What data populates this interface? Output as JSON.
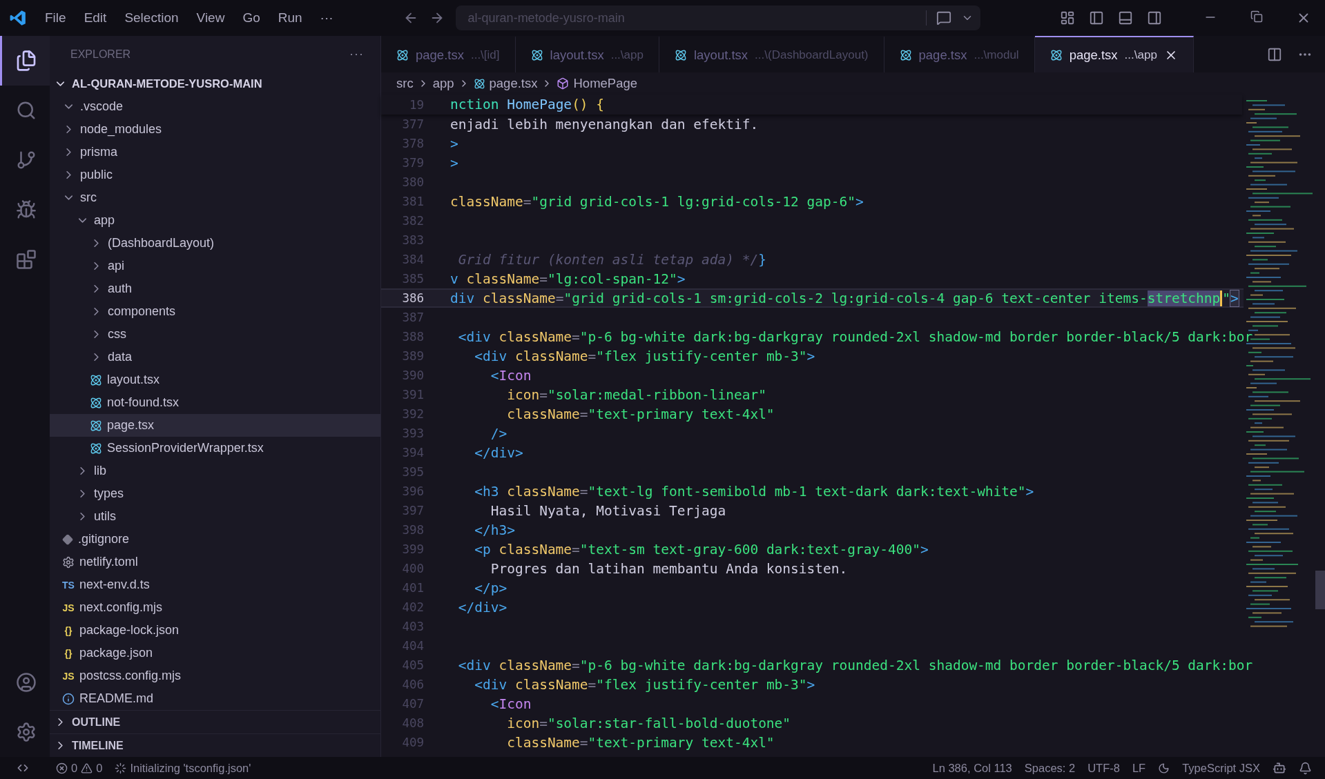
{
  "menu": [
    "File",
    "Edit",
    "Selection",
    "View",
    "Go",
    "Run",
    "···"
  ],
  "command_center": {
    "value": "al-quran-metode-yusro-main"
  },
  "sidebar": {
    "title": "EXPLORER",
    "more": "···",
    "root": {
      "label": "AL-QURAN-METODE-YUSRO-MAIN",
      "expanded": true
    },
    "tree": [
      {
        "name": ".vscode",
        "kind": "folder",
        "expanded": true,
        "selected": false
      },
      {
        "name": "node_modules",
        "kind": "folder",
        "expanded": false,
        "selected": false
      },
      {
        "name": "prisma",
        "kind": "folder",
        "expanded": false,
        "selected": false
      },
      {
        "name": "public",
        "kind": "folder",
        "expanded": false,
        "selected": false
      },
      {
        "name": "src",
        "kind": "folder",
        "expanded": true,
        "selected": false,
        "children": [
          {
            "name": "app",
            "kind": "folder",
            "expanded": true,
            "selected": false,
            "children": [
              {
                "name": "(DashboardLayout)",
                "kind": "folder",
                "expanded": false,
                "selected": false
              },
              {
                "name": "api",
                "kind": "folder",
                "expanded": false,
                "selected": false
              },
              {
                "name": "auth",
                "kind": "folder",
                "expanded": false,
                "selected": false
              },
              {
                "name": "components",
                "kind": "folder",
                "expanded": false,
                "selected": false
              },
              {
                "name": "css",
                "kind": "folder",
                "expanded": false,
                "selected": false
              },
              {
                "name": "data",
                "kind": "folder",
                "expanded": false,
                "selected": false
              },
              {
                "name": "layout.tsx",
                "kind": "react",
                "selected": false
              },
              {
                "name": "not-found.tsx",
                "kind": "react",
                "selected": false
              },
              {
                "name": "page.tsx",
                "kind": "react",
                "selected": true
              },
              {
                "name": "SessionProviderWrapper.tsx",
                "kind": "react",
                "selected": false
              }
            ]
          },
          {
            "name": "lib",
            "kind": "folder",
            "expanded": false,
            "selected": false
          },
          {
            "name": "types",
            "kind": "folder",
            "expanded": false,
            "selected": false
          },
          {
            "name": "utils",
            "kind": "folder",
            "expanded": false,
            "selected": false
          }
        ]
      },
      {
        "name": ".gitignore",
        "kind": "git",
        "selected": false
      },
      {
        "name": "netlify.toml",
        "kind": "gear",
        "selected": false
      },
      {
        "name": "next-env.d.ts",
        "kind": "ts",
        "glyph": "TS",
        "selected": false
      },
      {
        "name": "next.config.mjs",
        "kind": "js",
        "glyph": "JS",
        "selected": false
      },
      {
        "name": "package-lock.json",
        "kind": "json",
        "glyph": "{}",
        "selected": false
      },
      {
        "name": "package.json",
        "kind": "json",
        "glyph": "{}",
        "selected": false
      },
      {
        "name": "postcss.config.mjs",
        "kind": "js",
        "glyph": "JS",
        "selected": false
      },
      {
        "name": "README.md",
        "kind": "info",
        "selected": false
      }
    ],
    "sections": [
      {
        "label": "OUTLINE",
        "expanded": false
      },
      {
        "label": "TIMELINE",
        "expanded": false
      }
    ]
  },
  "tabs": [
    {
      "name": "page.tsx",
      "path": "...\\[id]",
      "selected": false
    },
    {
      "name": "layout.tsx",
      "path": "...\\app",
      "selected": false
    },
    {
      "name": "layout.tsx",
      "path": "...\\(DashboardLayout)",
      "selected": false
    },
    {
      "name": "page.tsx",
      "path": "...\\modul",
      "selected": false
    },
    {
      "name": "page.tsx",
      "path": "...\\app",
      "selected": true
    }
  ],
  "breadcrumb": [
    "src",
    "app",
    "page.tsx",
    "HomePage"
  ],
  "sticky_line": {
    "number": "19",
    "tokens": [
      {
        "text": "nction",
        "kind": "keyword"
      },
      {
        "text": " HomePage",
        "kind": "function"
      },
      {
        "text": "() {",
        "kind": "brace"
      }
    ]
  },
  "lines": [
    {
      "number": "377",
      "current": false,
      "tokens": [
        {
          "text": "enjadi lebih menyenangkan dan efektif.",
          "kind": "plain"
        }
      ]
    },
    {
      "number": "378",
      "current": false,
      "tokens": [
        {
          "text": ">",
          "kind": "tag"
        }
      ]
    },
    {
      "number": "379",
      "current": false,
      "tokens": [
        {
          "text": ">",
          "kind": "tag"
        }
      ]
    },
    {
      "number": "380",
      "current": false
    },
    {
      "number": "381",
      "current": false,
      "tokens": [
        {
          "text": "className",
          "kind": "attr"
        },
        {
          "text": "=",
          "kind": "op"
        },
        {
          "text": "\"grid grid-cols-1 lg:grid-cols-12 gap-6\"",
          "kind": "string"
        },
        {
          "text": ">",
          "kind": "tag"
        }
      ]
    },
    {
      "number": "382",
      "current": false
    },
    {
      "number": "383",
      "current": false
    },
    {
      "number": "384",
      "current": false,
      "tokens": [
        {
          "text": " Grid fitur (konten asli tetap ada) */",
          "kind": "comment"
        },
        {
          "text": "}",
          "kind": "tag"
        }
      ]
    },
    {
      "number": "385",
      "current": false,
      "tokens": [
        {
          "text": "v",
          "kind": "tag"
        },
        {
          "text": " className",
          "kind": "attr"
        },
        {
          "text": "=",
          "kind": "op"
        },
        {
          "text": "\"lg:col-span-12\"",
          "kind": "string"
        },
        {
          "text": ">",
          "kind": "tag"
        }
      ]
    },
    {
      "number": "386",
      "current": true,
      "tokens": [
        {
          "text": "div",
          "kind": "tag"
        },
        {
          "text": " className",
          "kind": "attr"
        },
        {
          "text": "=",
          "kind": "op"
        },
        {
          "text": "\"grid grid-cols-1 sm:grid-cols-2 lg:grid-cols-4 gap-6 text-center items-",
          "kind": "string"
        },
        {
          "text": "stretchnp",
          "kind": "selection"
        },
        {
          "text": "\"",
          "kind": "string"
        },
        {
          "text": ">",
          "kind": "match"
        }
      ]
    },
    {
      "number": "387",
      "current": false
    },
    {
      "number": "388",
      "current": false,
      "tokens": [
        {
          "text": " <div",
          "kind": "tag"
        },
        {
          "text": " className",
          "kind": "attr"
        },
        {
          "text": "=",
          "kind": "op"
        },
        {
          "text": "\"p-6 bg-white dark:bg-darkgray rounded-2xl shadow-md border border-black/5 dark:bor",
          "kind": "string"
        }
      ]
    },
    {
      "number": "389",
      "current": false,
      "tokens": [
        {
          "text": "   <div",
          "kind": "tag"
        },
        {
          "text": " className",
          "kind": "attr"
        },
        {
          "text": "=",
          "kind": "op"
        },
        {
          "text": "\"flex justify-center mb-3\"",
          "kind": "string"
        },
        {
          "text": ">",
          "kind": "tag"
        }
      ]
    },
    {
      "number": "390",
      "current": false,
      "tokens": [
        {
          "text": "     <",
          "kind": "tag"
        },
        {
          "text": "Icon",
          "kind": "component"
        }
      ]
    },
    {
      "number": "391",
      "current": false,
      "tokens": [
        {
          "text": "       icon",
          "kind": "attr"
        },
        {
          "text": "=",
          "kind": "op"
        },
        {
          "text": "\"solar:medal-ribbon-linear\"",
          "kind": "string"
        }
      ]
    },
    {
      "number": "392",
      "current": false,
      "tokens": [
        {
          "text": "       className",
          "kind": "attr"
        },
        {
          "text": "=",
          "kind": "op"
        },
        {
          "text": "\"text-primary text-4xl\"",
          "kind": "string"
        }
      ]
    },
    {
      "number": "393",
      "current": false,
      "tokens": [
        {
          "text": "     />",
          "kind": "tag"
        }
      ]
    },
    {
      "number": "394",
      "current": false,
      "tokens": [
        {
          "text": "   </div>",
          "kind": "tag"
        }
      ]
    },
    {
      "number": "395",
      "current": false
    },
    {
      "number": "396",
      "current": false,
      "tokens": [
        {
          "text": "   <h3",
          "kind": "tag"
        },
        {
          "text": " className",
          "kind": "attr"
        },
        {
          "text": "=",
          "kind": "op"
        },
        {
          "text": "\"text-lg font-semibold mb-1 text-dark dark:text-white\"",
          "kind": "string"
        },
        {
          "text": ">",
          "kind": "tag"
        }
      ]
    },
    {
      "number": "397",
      "current": false,
      "tokens": [
        {
          "text": "     Hasil Nyata, Motivasi Terjaga",
          "kind": "plain"
        }
      ]
    },
    {
      "number": "398",
      "current": false,
      "tokens": [
        {
          "text": "   </h3>",
          "kind": "tag"
        }
      ]
    },
    {
      "number": "399",
      "current": false,
      "tokens": [
        {
          "text": "   <p",
          "kind": "tag"
        },
        {
          "text": " className",
          "kind": "attr"
        },
        {
          "text": "=",
          "kind": "op"
        },
        {
          "text": "\"text-sm text-gray-600 dark:text-gray-400\"",
          "kind": "string"
        },
        {
          "text": ">",
          "kind": "tag"
        }
      ]
    },
    {
      "number": "400",
      "current": false,
      "tokens": [
        {
          "text": "     Progres dan latihan membantu Anda konsisten.",
          "kind": "plain"
        }
      ]
    },
    {
      "number": "401",
      "current": false,
      "tokens": [
        {
          "text": "   </p>",
          "kind": "tag"
        }
      ]
    },
    {
      "number": "402",
      "current": false,
      "tokens": [
        {
          "text": " </div>",
          "kind": "tag"
        }
      ]
    },
    {
      "number": "403",
      "current": false
    },
    {
      "number": "404",
      "current": false
    },
    {
      "number": "405",
      "current": false,
      "tokens": [
        {
          "text": " <div",
          "kind": "tag"
        },
        {
          "text": " className",
          "kind": "attr"
        },
        {
          "text": "=",
          "kind": "op"
        },
        {
          "text": "\"p-6 bg-white dark:bg-darkgray rounded-2xl shadow-md border border-black/5 dark:bor",
          "kind": "string"
        }
      ]
    },
    {
      "number": "406",
      "current": false,
      "tokens": [
        {
          "text": "   <div",
          "kind": "tag"
        },
        {
          "text": " className",
          "kind": "attr"
        },
        {
          "text": "=",
          "kind": "op"
        },
        {
          "text": "\"flex justify-center mb-3\"",
          "kind": "string"
        },
        {
          "text": ">",
          "kind": "tag"
        }
      ]
    },
    {
      "number": "407",
      "current": false,
      "tokens": [
        {
          "text": "     <",
          "kind": "tag"
        },
        {
          "text": "Icon",
          "kind": "component"
        }
      ]
    },
    {
      "number": "408",
      "current": false,
      "tokens": [
        {
          "text": "       icon",
          "kind": "attr"
        },
        {
          "text": "=",
          "kind": "op"
        },
        {
          "text": "\"solar:star-fall-bold-duotone\"",
          "kind": "string"
        }
      ]
    },
    {
      "number": "409",
      "current": false,
      "tokens": [
        {
          "text": "       className",
          "kind": "attr"
        },
        {
          "text": "=",
          "kind": "op"
        },
        {
          "text": "\"text-primary text-4xl\"",
          "kind": "string"
        }
      ]
    }
  ],
  "status_bar": {
    "errors": "0",
    "warnings": "0",
    "task": "Initializing 'tsconfig.json'",
    "position": "Ln 386, Col 113",
    "indent": "Spaces: 2",
    "encoding": "UTF-8",
    "eol": "LF",
    "language": "TypeScript JSX"
  }
}
